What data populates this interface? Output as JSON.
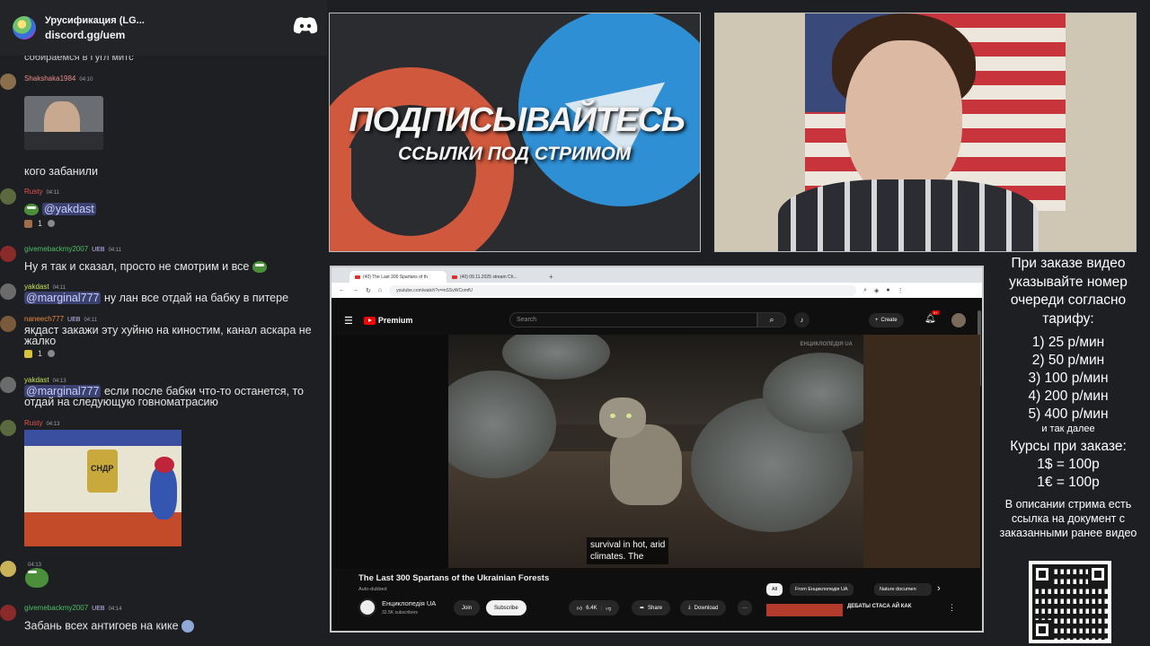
{
  "chat": {
    "server_title": "Урусификация (LG...",
    "invite": "discord.gg/uem",
    "cutoff_text": "собираемся в Гугл митс",
    "messages": [
      {
        "user": "Shakshaka1984",
        "time": "04:10",
        "text": "кого забанили",
        "color": "#e78c8c"
      },
      {
        "user": "Rusty",
        "time": "04:11",
        "text": "@yakdast",
        "color": "#e7524f",
        "reaction_count": "1"
      },
      {
        "user": "givemebackmy2007",
        "badge": "UEB",
        "time": "04:11",
        "text": "Ну я так и сказал, просто не смотрим и все",
        "color": "#4fbf67"
      },
      {
        "user": "yakdast",
        "time": "04:11",
        "mention": "@marginal777",
        "text": "ну лан все отдай на бабку в питере",
        "color": "#c6e35b"
      },
      {
        "user": "naneech777",
        "badge": "UEB",
        "time": "04:11",
        "text": "якдаст закажи эту хуйню на киностим, канал аскара не жалко",
        "color": "#ea8a3b",
        "reaction_count": "1"
      },
      {
        "user": "yakdast",
        "time": "04:13",
        "mention": "@marginal777",
        "text": "если после бабки что-то останется, то отдай на следующую говноматрасию",
        "color": "#c6e35b"
      },
      {
        "user": "Rusty",
        "time": "04:13",
        "image_label": "СНДР",
        "color": "#e7524f"
      },
      {
        "user": "",
        "time": "04:13",
        "color": "#e6e6e6"
      },
      {
        "user": "givemebackmy2007",
        "badge": "UEB",
        "time": "04:14",
        "text": "Забань всех антигоев на кике",
        "color": "#4fbf67"
      }
    ]
  },
  "promo": {
    "line1": "ПОДПИСЫВАЙТЕСЬ",
    "line2": "ССЫЛКИ ПОД СТРИМОМ"
  },
  "browser": {
    "tabs": [
      "(40) The Last 300 Spartans of th",
      "(40) 09.11.2025 stream Ch..."
    ],
    "url": "youtube.com/watch?v=mSSvWComfU",
    "yt": {
      "brand": "Premium",
      "search_placeholder": "Search",
      "create": "Create",
      "notif_count": "9+",
      "watermark": "ЕНЦИКЛОПЕДІЯ UA",
      "caption_line1": "survival in hot, arid",
      "caption_line2": "climates.   The",
      "video_title": "The Last 300 Spartans of the Ukrainian Forests",
      "auto_dubbed": "Auto-dubbed",
      "channel": "Енциклопедія UA",
      "subscribers": "32.5K subscribers",
      "join": "Join",
      "subscribe": "Subscribe",
      "likes": "6.4K",
      "share": "Share",
      "download": "Download",
      "chips": [
        "All",
        "From Енциклопедія UA",
        "Nature documen"
      ],
      "rec_title": "ДЕБАТЫ СТАСА АЙ КАК"
    }
  },
  "info": {
    "head": "При заказе видео указывайте номер очереди согласно тарифу:",
    "tariffs": [
      "1) 25 р/мин",
      "2) 50 р/мин",
      "3) 100 р/мин",
      "4) 200 р/мин",
      "5) 400 р/мин"
    ],
    "etc": "и так далее",
    "rates_head": "Курсы при заказе:",
    "rates": [
      "1$ = 100р",
      "1€ = 100р"
    ],
    "desc": "В описании стрима есть ссылка на документ с заказанными ранее видео"
  }
}
